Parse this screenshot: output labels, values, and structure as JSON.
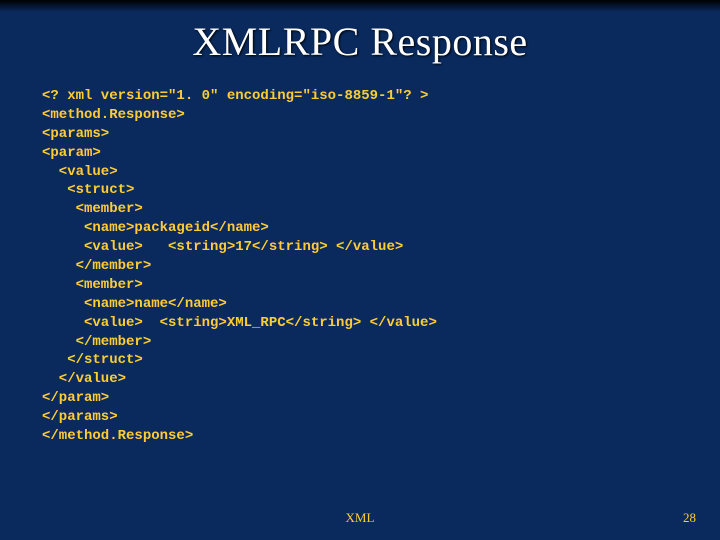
{
  "title": "XMLRPC Response",
  "code_lines": [
    "<? xml version=\"1. 0\" encoding=\"iso-8859-1\"? >",
    "<method.Response>",
    "<params>",
    "<param>",
    "  <value>",
    "   <struct>",
    "    <member>",
    "     <name>packageid</name>",
    "     <value>   <string>17</string> </value>",
    "    </member>",
    "    <member>",
    "     <name>name</name>",
    "     <value>  <string>XML_RPC</string> </value>",
    "    </member>",
    "   </struct>",
    "  </value>",
    "</param>",
    "</params>",
    "</method.Response>"
  ],
  "footer": {
    "center": "XML",
    "page": "28"
  }
}
